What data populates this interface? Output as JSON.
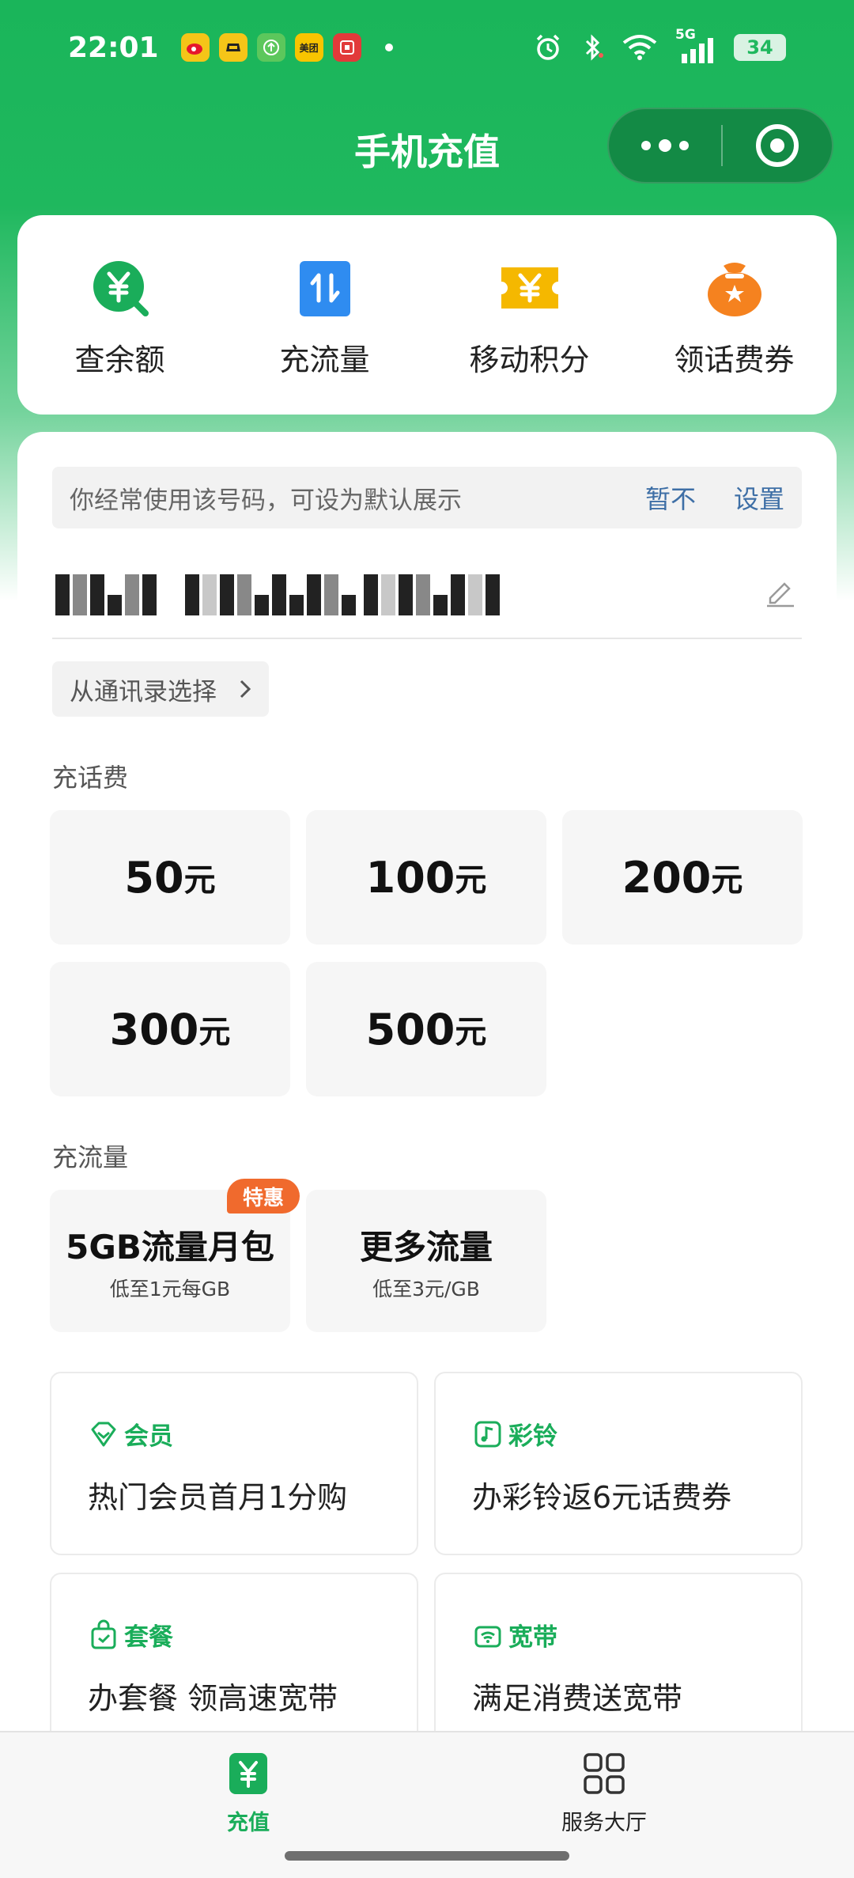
{
  "status_bar": {
    "time": "22:01",
    "notifications": [
      "weibo-icon",
      "taxi-icon",
      "upload-icon",
      "meituan-icon",
      "icbc-icon"
    ],
    "meituan_text": "美团",
    "network": "5G",
    "battery": "34"
  },
  "header": {
    "title": "手机充值"
  },
  "quick_actions": [
    {
      "label": "查余额",
      "icon": "balance-check-icon",
      "color": "#1aad5a"
    },
    {
      "label": "充流量",
      "icon": "data-transfer-icon",
      "color": "#2f8cf0"
    },
    {
      "label": "移动积分",
      "icon": "points-ticket-icon",
      "color": "#f5b800"
    },
    {
      "label": "领话费券",
      "icon": "coupon-bag-icon",
      "color": "#f5821f"
    }
  ],
  "default_number": {
    "tip": "你经常使用该号码，可设为默认展示",
    "dismiss": "暂不",
    "set": "设置"
  },
  "contact_select": {
    "label": "从通讯录选择"
  },
  "topup": {
    "title": "充话费",
    "unit": "元",
    "amounts": [
      "50",
      "100",
      "200",
      "300",
      "500"
    ]
  },
  "data_section": {
    "title": "充流量",
    "items": [
      {
        "title": "5GB流量月包",
        "sub": "低至1元每GB",
        "badge": "特惠"
      },
      {
        "title": "更多流量",
        "sub": "低至3元/GB"
      }
    ]
  },
  "services": [
    {
      "tag": "会员",
      "desc": "热门会员首月1分购",
      "icon": "membership-diamond-icon"
    },
    {
      "tag": "彩铃",
      "desc": "办彩铃返6元话费券",
      "icon": "ringtone-music-icon"
    },
    {
      "tag": "套餐",
      "desc": "办套餐 领高速宽带",
      "icon": "package-bag-icon"
    },
    {
      "tag": "宽带",
      "desc": "满足消费送宽带",
      "icon": "broadband-router-icon"
    }
  ],
  "bottom_nav": [
    {
      "label": "充值",
      "icon": "recharge-yuan-icon",
      "active": true
    },
    {
      "label": "服务大厅",
      "icon": "service-grid-icon",
      "active": false
    }
  ],
  "colors": {
    "brand_green": "#1fb85e",
    "link_blue": "#3e6fa6",
    "badge_orange": "#f06a2d"
  }
}
